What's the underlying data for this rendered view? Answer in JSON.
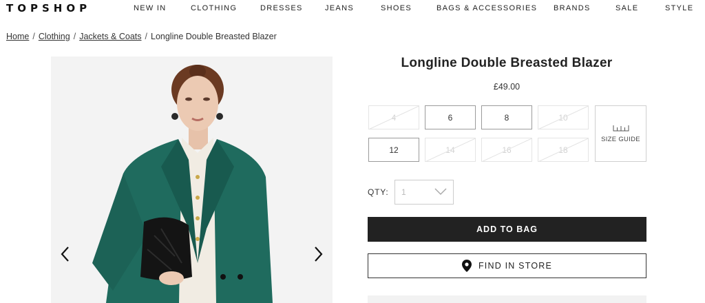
{
  "header": {
    "logo": "TOPSHOP",
    "nav": [
      "NEW IN",
      "CLOTHING",
      "DRESSES",
      "JEANS",
      "SHOES",
      "BAGS & ACCESSORIES",
      "BRANDS",
      "SALE",
      "STYLE"
    ]
  },
  "breadcrumb": {
    "home": "Home",
    "clothing": "Clothing",
    "category": "Jackets & Coats",
    "current": "Longline Double Breasted Blazer",
    "separator": "/"
  },
  "gallery": {
    "prev_icon": "chevron-left-icon",
    "next_icon": "chevron-right-icon",
    "image_subject": "model-in-green-blazer"
  },
  "product": {
    "title": "Longline Double Breasted Blazer",
    "price": "£49.00",
    "sizes": [
      {
        "label": "4",
        "available": false
      },
      {
        "label": "6",
        "available": true
      },
      {
        "label": "8",
        "available": true
      },
      {
        "label": "10",
        "available": false
      },
      {
        "label": "12",
        "available": true
      },
      {
        "label": "14",
        "available": false
      },
      {
        "label": "16",
        "available": false
      },
      {
        "label": "18",
        "available": false
      }
    ],
    "size_guide_label": "SIZE GUIDE",
    "size_guide_icon": "ruler-icon",
    "qty_label": "QTY:",
    "qty_value": "1",
    "add_to_bag_label": "ADD TO BAG",
    "find_in_store_label": "FIND IN STORE",
    "find_in_store_icon": "map-pin-icon"
  },
  "colors": {
    "primary_button": "#222222",
    "blazer_green": "#1f6b5e",
    "border": "#cccccc"
  }
}
